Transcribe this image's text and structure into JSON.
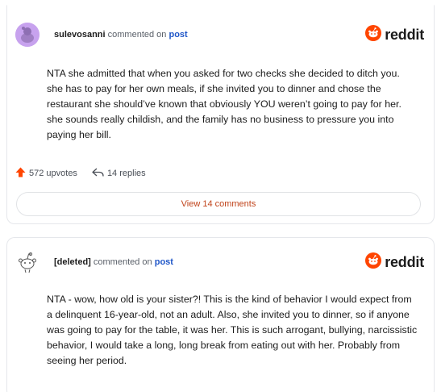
{
  "brand": {
    "wordmark": "reddit",
    "accent_color": "#ff4500"
  },
  "comments": [
    {
      "username": "sulevosanni",
      "action_text": "commented on",
      "link_text": "post",
      "avatar_icon": "snoo-avatar-icon",
      "body": "NTA she admitted that when you asked for two checks she decided to ditch you. she has to pay for her own meals, if she invited you to dinner and chose the restaurant she should’ve known that obviously YOU weren’t going to pay for her. she sounds really childish, and the family has no business to pressure you into paying her bill.",
      "upvotes_label": "572 upvotes",
      "replies_label": "14 replies",
      "view_comments_label": "View 14 comments"
    },
    {
      "username": "[deleted]",
      "action_text": "commented on",
      "link_text": "post",
      "avatar_icon": "deleted-user-avatar-icon",
      "body": "NTA - wow, how old is your sister?! This is the kind of behavior I would expect from a delinquent 16-year-old, not an adult. Also, she invited you to dinner, so if anyone was going to pay for the table, it was her. This is such arrogant, bullying, narcissistic behavior, I would take a long, long break from eating out with her. Probably from seeing her period."
    }
  ]
}
